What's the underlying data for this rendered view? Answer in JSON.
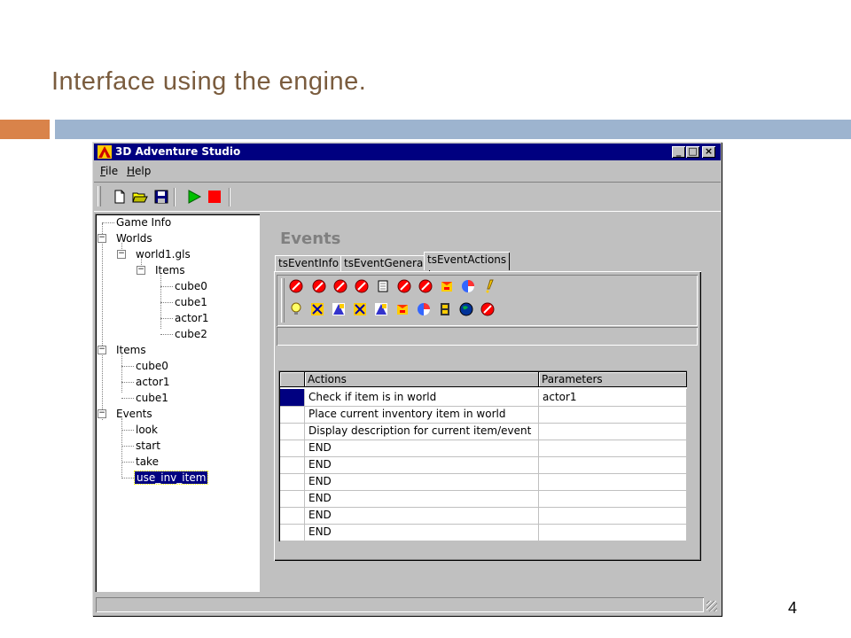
{
  "slide": {
    "title": "Interface using the engine.",
    "page_number": "4",
    "colors": {
      "accent_orange": "#d9834a",
      "accent_blue": "#9db4cf",
      "title_color": "#7a5c3e"
    }
  },
  "window": {
    "title": "3D Adventure Studio",
    "buttons": {
      "minimize": "_",
      "maximize": "□",
      "close": "×"
    },
    "menu": [
      {
        "label": "File",
        "mnemonic": "F"
      },
      {
        "label": "Help",
        "mnemonic": "H"
      }
    ],
    "toolbar": [
      "new-file-icon",
      "open-folder-icon",
      "save-icon",
      "play-icon",
      "stop-icon"
    ]
  },
  "tree": {
    "game_info": "Game Info",
    "worlds": "Worlds",
    "world_file": "world1.gls",
    "world_items": "Items",
    "world_items_children": [
      "cube0",
      "cube1",
      "actor1",
      "cube2"
    ],
    "items": "Items",
    "items_children": [
      "cube0",
      "actor1",
      "cube1"
    ],
    "events": "Events",
    "events_children": [
      "look",
      "start",
      "take",
      "use_inv_item"
    ],
    "selected": "use_inv_item"
  },
  "panel": {
    "heading": "Events",
    "tabs": [
      "tsEventInfo",
      "tsEventGeneral",
      "tsEventActions"
    ],
    "active_tab": "tsEventActions"
  },
  "grid": {
    "columns": [
      "Actions",
      "Parameters"
    ],
    "rows": [
      {
        "action": "Check if item is in world",
        "param": "actor1"
      },
      {
        "action": "Place current inventory item in world",
        "param": ""
      },
      {
        "action": "Display description for current item/event",
        "param": ""
      },
      {
        "action": "END",
        "param": ""
      },
      {
        "action": "END",
        "param": ""
      },
      {
        "action": "END",
        "param": ""
      },
      {
        "action": "END",
        "param": ""
      },
      {
        "action": "END",
        "param": ""
      },
      {
        "action": "END",
        "param": ""
      }
    ]
  }
}
